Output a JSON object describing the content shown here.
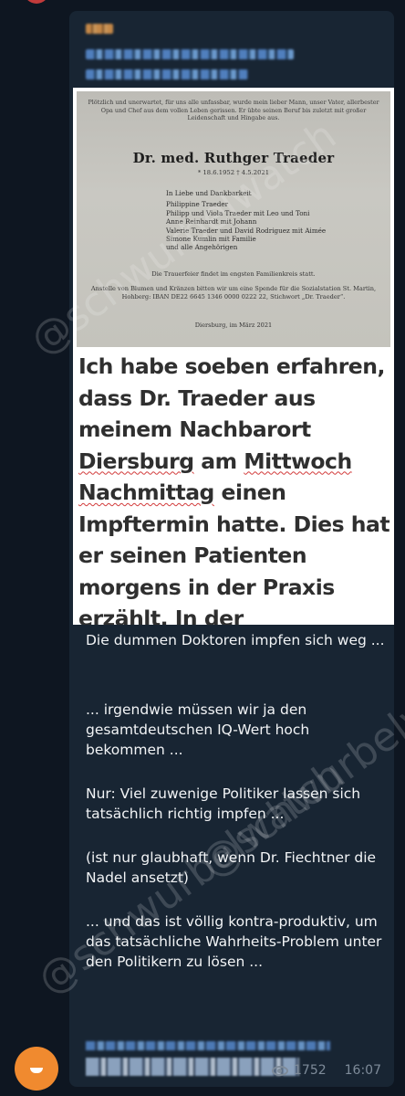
{
  "post": {
    "obituary": {
      "intro": "Plötzlich und unerwartet, für uns alle unfassbar, wurde mein lieber Mann, unser Vater, allerbester Opa und Chef aus dem vollen Leben gerissen. Er übte seinen Beruf bis zuletzt mit großer Leidenschaft und Hingabe aus.",
      "name": "Dr. med. Ruthger Traeder",
      "dates": "* 18.6.1952     † 4.5.2021",
      "mourners": [
        "In Liebe und Dankbarkeit",
        "Philippine Traeder",
        "Philipp und Viola Traeder mit Leo und Toni",
        "Anne Reinhardt mit Johann",
        "Valerie Traeder und David Rodriguez mit Aimée",
        "Simone Kumlin mit Familie",
        "und alle Angehörigen"
      ],
      "closing": "Die Trauerfeier findet im engsten Familienkreis statt.",
      "donation": "Anstelle von Blumen und Kränzen bitten wir um eine Spende für die Sozialstation St. Martin, Hohberg: IBAN DE22 6645 1346 0000 0222 22, Stichwort „Dr. Traeder“.",
      "place": "Diersburg, im März 2021"
    },
    "headline": {
      "part1": "Ich habe soeben erfahren, dass Dr. Traeder aus meinem Nachbarort ",
      "underlined1": "Diersburg",
      "part2": " am ",
      "underlined2": "Mittwoch Nachmittag",
      "part3": " einen Impftermin hatte. Dies hat er seinen Patienten morgens in der Praxis erzählt. In der darauffolgenden Nacht ist er verstorben"
    },
    "paragraphs": [
      "Die dummen Doktoren impfen sich weg ...",
      "... irgendwie müssen wir ja den gesamtdeutschen IQ-Wert hoch bekommen ...",
      "Nur: Viel zuwenige Politiker lassen sich tatsächlich richtig impfen ...",
      "(ist nur glaubhaft, wenn Dr. Fiechtner die Nadel ansetzt)",
      "... und das ist völlig kontra-produktiv, um das tatsächliche Wahrheits-Problem unter den Politikern zu lösen ..."
    ],
    "views": "1752",
    "time": "16:07"
  },
  "watermarks": [
    "@schwurbelwatch",
    "@schwurbelwatch",
    "@schwurbelwatch"
  ],
  "colors": {
    "background": "#0e1621",
    "bubble": "#182533",
    "avatar": "#f08a2f"
  }
}
